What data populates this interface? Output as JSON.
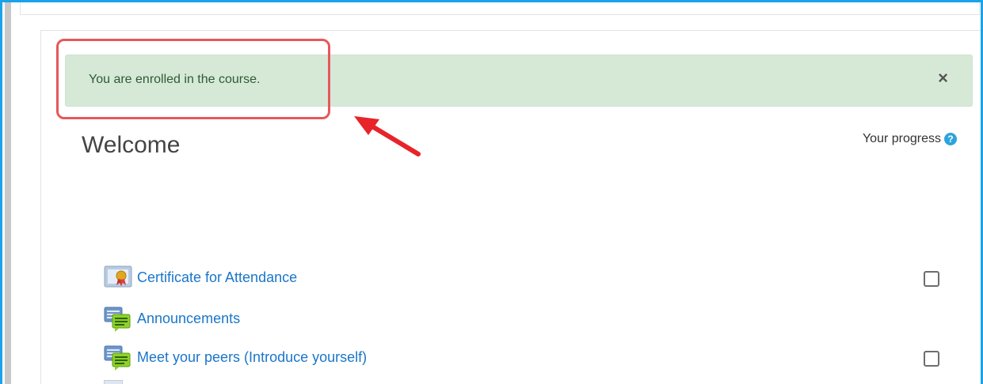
{
  "alert": {
    "message": "You are enrolled in the course.",
    "close_glyph": "×"
  },
  "section": {
    "title": "Welcome",
    "progress_label": "Your progress",
    "help_glyph": "?"
  },
  "activities": [
    {
      "label": "Certificate for Attendance",
      "icon": "certificate-icon",
      "has_checkbox": true
    },
    {
      "label": "Announcements",
      "icon": "forum-icon",
      "has_checkbox": false
    },
    {
      "label": "Meet your peers (Introduce yourself)",
      "icon": "forum-icon",
      "has_checkbox": true
    }
  ],
  "colors": {
    "frame_border": "#1aa3e8",
    "alert_bg": "#d6e9d7",
    "alert_text": "#2f5a33",
    "highlight": "#e8575b",
    "arrow": "#e8232a",
    "link": "#1a76c9",
    "help_icon": "#2ca4dc"
  }
}
